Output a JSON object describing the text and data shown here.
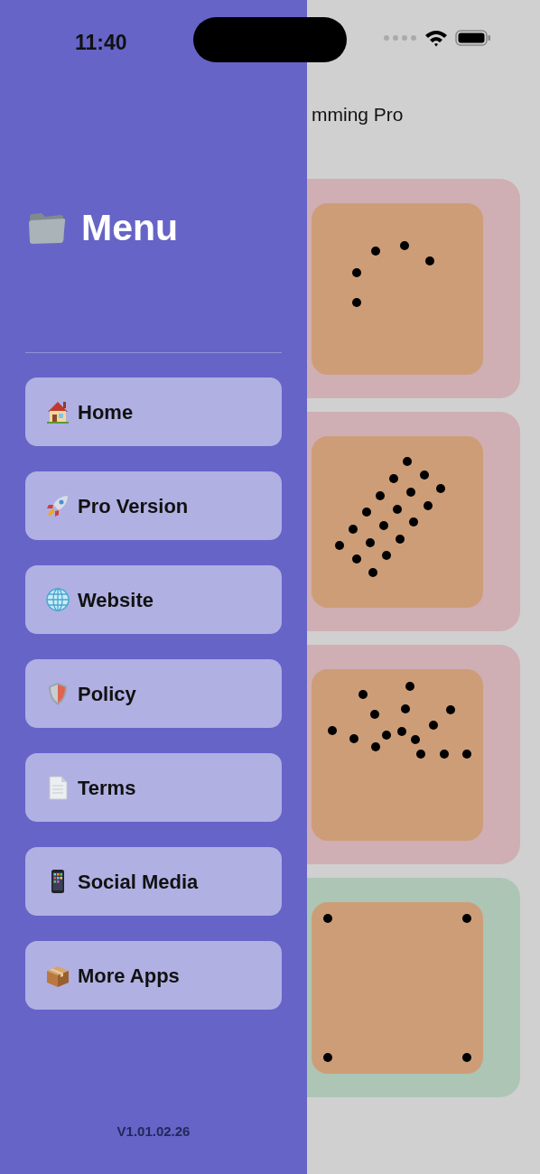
{
  "status_bar": {
    "time": "11:40"
  },
  "screen_title": "mming Pro",
  "cards": [
    {
      "color": "#cfafb4"
    },
    {
      "color": "#cfafb4"
    },
    {
      "color": "#cfafb4"
    },
    {
      "color": "#adc5b5"
    }
  ],
  "menu": {
    "title": "Menu",
    "items": [
      {
        "label": "Home"
      },
      {
        "label": "Pro Version"
      },
      {
        "label": "Website"
      },
      {
        "label": "Policy"
      },
      {
        "label": "Terms"
      },
      {
        "label": "Social Media"
      },
      {
        "label": "More Apps"
      }
    ],
    "version": "V1.01.02.26"
  }
}
